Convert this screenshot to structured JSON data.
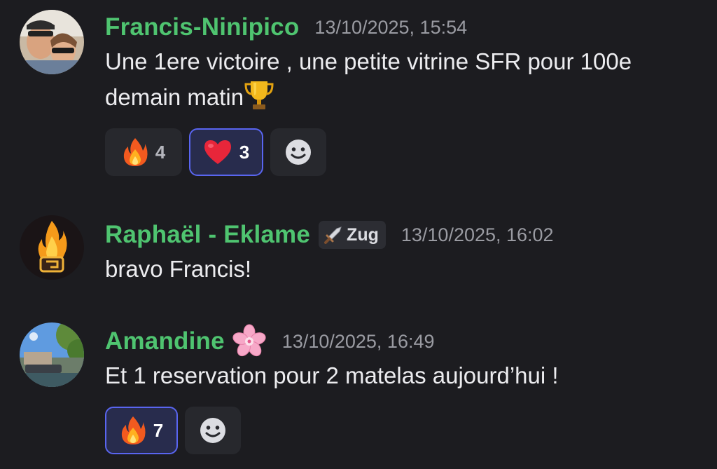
{
  "messages": [
    {
      "username": "Francis-Ninipico",
      "timestamp": "13/10/2025, 15:54",
      "text": "Une 1ere victoire , une petite vitrine SFR pour 100e demain matin",
      "inline_emoji": "trophy-icon",
      "reactions": [
        {
          "emoji": "fire-icon",
          "count": "4",
          "active": false
        },
        {
          "emoji": "red-heart-icon",
          "count": "3",
          "active": true
        }
      ]
    },
    {
      "username": "Raphaël - Eklame",
      "role_tag": "Zug",
      "role_icon": "sword-icon",
      "timestamp": "13/10/2025, 16:02",
      "text": "bravo Francis!"
    },
    {
      "username": "Amandine",
      "name_emoji": "cherry-blossom-icon",
      "timestamp": "13/10/2025, 16:49",
      "text": "Et 1 reservation pour 2 matelas aujourd’hui !",
      "reactions": [
        {
          "emoji": "fire-icon",
          "count": "7",
          "active": true
        }
      ]
    }
  ],
  "colors": {
    "background": "#1c1c20",
    "username": "#4fc470",
    "timestamp": "#9a9ba2",
    "reaction_bg": "#27282d",
    "reaction_active_border": "#5965f0"
  }
}
